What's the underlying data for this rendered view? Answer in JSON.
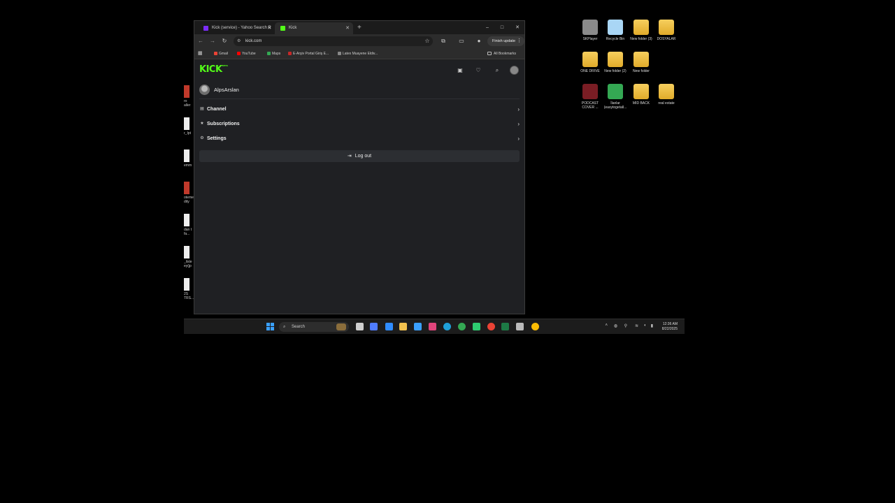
{
  "desktop": {
    "icons": [
      {
        "label": "SKPlayer",
        "color": "#8a8a8a"
      },
      {
        "label": "Recycle Bin",
        "color": "#a9d6f5"
      },
      {
        "label": "New folder (3)",
        "color": "folder"
      },
      {
        "label": "DOSYALAR",
        "color": "folder"
      },
      {
        "label": "ONE DRIVE",
        "color": "folder"
      },
      {
        "label": "New folder (2)",
        "color": "folder"
      },
      {
        "label": "New folder",
        "color": "folder"
      },
      {
        "label": "PODCAST COVER ...",
        "color": "#7a1d24"
      },
      {
        "label": "İlanlar (easytogetall...",
        "color": "#34a853"
      },
      {
        "label": "MID BACK",
        "color": "folder"
      },
      {
        "label": "real estate",
        "color": "folder"
      }
    ],
    "left_stubs": [
      "ro aller",
      "r_Ipt",
      "emm",
      "oteme dity",
      "dan t fa...",
      "_liste ey(jp",
      "2S TRS..."
    ]
  },
  "browser": {
    "tabs": [
      {
        "title": "Kick (service) - Yahoo Search R",
        "active": false,
        "favicon_color": "#7b2cf7"
      },
      {
        "title": "Kick",
        "active": true,
        "favicon_color": "#53fc18"
      }
    ],
    "new_tab_label": "+",
    "window_controls": {
      "minimize": "–",
      "maximize": "□",
      "close": "✕"
    },
    "address": "kick.com",
    "finish_update_label": "Finish update",
    "bookmarks": [
      {
        "label": "Gmail",
        "color": "#ea4335"
      },
      {
        "label": "YouTube",
        "color": "#ff0000"
      },
      {
        "label": "Maps",
        "color": "#34a853"
      },
      {
        "label": "E-Arşiv Portal Giriş E...",
        "color": "#c62828"
      },
      {
        "label": "Latex Muayene Eldiv...",
        "color": "#888888"
      }
    ],
    "all_bookmarks_label": "All Bookmarks"
  },
  "kick": {
    "logo": "KICK",
    "logo_badge": "BETA",
    "username": "AlpsArslan",
    "menu": [
      {
        "label": "Channel",
        "icon": "channel-icon",
        "glyph": "▤"
      },
      {
        "label": "Subscriptions",
        "icon": "subscriptions-icon",
        "glyph": "★"
      },
      {
        "label": "Settings",
        "icon": "gear-icon",
        "glyph": "⚙"
      }
    ],
    "logout_label": "Log out",
    "colors": {
      "brand": "#53fc18",
      "bg": "#1f2023"
    }
  },
  "taskbar": {
    "search_placeholder": "Search",
    "clock_time": "12:36 AM",
    "clock_date": "8/22/2025"
  }
}
